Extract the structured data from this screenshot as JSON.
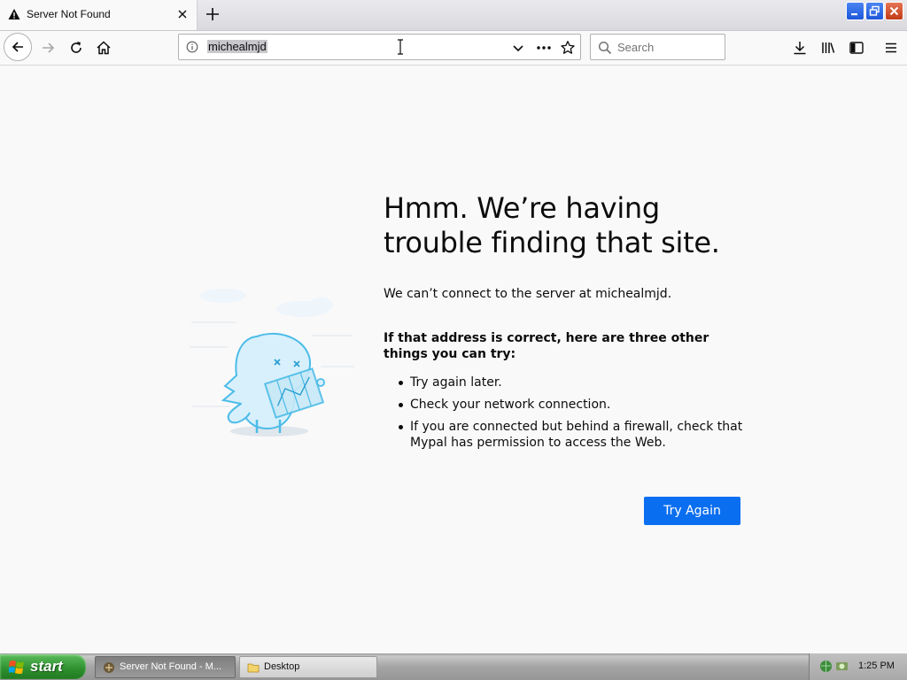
{
  "tab": {
    "title": "Server Not Found"
  },
  "urlbar": {
    "value": "michealmjd"
  },
  "search": {
    "placeholder": "Search"
  },
  "error": {
    "heading": "Hmm. We’re having trouble finding that site.",
    "description": "We can’t connect to the server at michealmjd.",
    "subheading": "If that address is correct, here are three other things you can try:",
    "tips": [
      "Try again later.",
      "Check your network connection.",
      "If you are connected but behind a firewall, check that Mypal has permission to access the Web."
    ],
    "button": "Try Again"
  },
  "taskbar": {
    "start_label": "start",
    "items": [
      {
        "label": "Server Not Found - M..."
      },
      {
        "label": "Desktop"
      }
    ],
    "clock": "1:25 PM"
  },
  "colors": {
    "accent": "#0a6ef0",
    "page_bg": "#f9f9fa",
    "start_green": "#2d8f2d"
  },
  "icons": [
    "warning-icon",
    "close-icon",
    "plus-icon",
    "back-icon",
    "forward-icon",
    "reload-icon",
    "home-icon",
    "info-icon",
    "chevron-down-icon",
    "more-icon",
    "star-icon",
    "search-icon",
    "download-icon",
    "library-icon",
    "sidebar-icon",
    "menu-icon",
    "windows-logo-icon",
    "folder-icon"
  ]
}
